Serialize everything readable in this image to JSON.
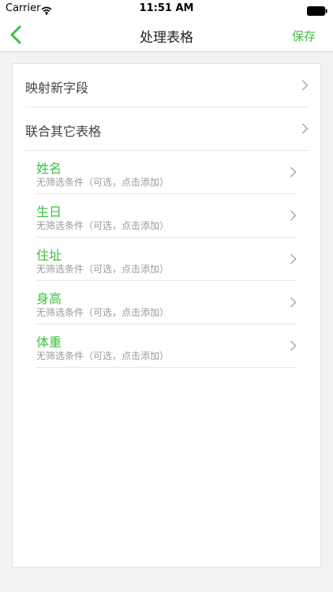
{
  "status_bar": {
    "carrier": "Carrier",
    "time": "11:51 AM"
  },
  "nav": {
    "title": "处理表格",
    "save_label": "保存",
    "back_icon": "chevron-left-icon",
    "accent_color": "#3cbf40"
  },
  "menu": [
    {
      "label": "映射新字段"
    },
    {
      "label": "联合其它表格"
    }
  ],
  "fields": [
    {
      "name": "姓名",
      "desc": "无筛选条件（可选，点击添加）"
    },
    {
      "name": "生日",
      "desc": "无筛选条件（可选，点击添加）"
    },
    {
      "name": "住址",
      "desc": "无筛选条件（可选，点击添加）"
    },
    {
      "name": "身高",
      "desc": "无筛选条件（可选，点击添加）"
    },
    {
      "name": "体重",
      "desc": "无筛选条件（可选，点击添加）"
    }
  ]
}
